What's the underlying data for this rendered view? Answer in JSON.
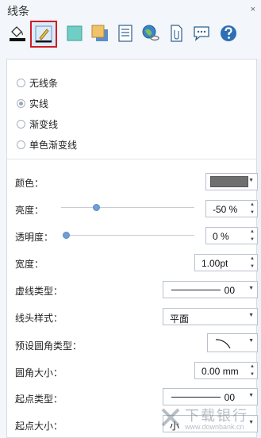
{
  "window": {
    "title": "线条",
    "close_glyph": "×"
  },
  "toolbar": {
    "buttons": [
      {
        "name": "fill-bucket-icon",
        "selected": false
      },
      {
        "name": "line-pen-icon",
        "selected": true
      },
      {
        "name": "teal-fill-icon",
        "selected": false
      },
      {
        "name": "shadow-icon",
        "selected": false
      },
      {
        "name": "document-list-icon",
        "selected": false
      },
      {
        "name": "globe-link-icon",
        "selected": false
      },
      {
        "name": "attachment-icon",
        "selected": false
      },
      {
        "name": "comment-icon",
        "selected": false
      },
      {
        "name": "help-icon",
        "selected": false
      }
    ]
  },
  "line_types": [
    {
      "label": "无线条",
      "checked": false
    },
    {
      "label": "实线",
      "checked": true
    },
    {
      "label": "渐变线",
      "checked": false
    },
    {
      "label": "单色渐变线",
      "checked": false
    }
  ],
  "properties": {
    "color": {
      "label": "颜色：",
      "value": "#6f6f6f"
    },
    "brightness": {
      "label": "亮度：",
      "value": "-50 %",
      "slider_fraction": 0.25
    },
    "transparency": {
      "label": "透明度：",
      "value": "0 %",
      "slider_fraction": 0.0
    },
    "width": {
      "label": "宽度：",
      "value": "1.00pt"
    },
    "dash_type": {
      "label": "虚线类型：",
      "value": "00"
    },
    "cap_style": {
      "label": "线头样式：",
      "value": "平面"
    },
    "corner_type": {
      "label": "预设圆角类型："
    },
    "corner_size": {
      "label": "圆角大小：",
      "value": "0.00 mm"
    },
    "start_type": {
      "label": "起点类型：",
      "value": "00"
    },
    "start_size": {
      "label": "起点大小：",
      "value": "小"
    }
  },
  "watermark": {
    "text": "下载银行",
    "url": "www.downbank.cn"
  },
  "colors": {
    "accent": "#d01d25",
    "slider": "#6e9fd6",
    "panel_bg": "#f3f6fa"
  }
}
